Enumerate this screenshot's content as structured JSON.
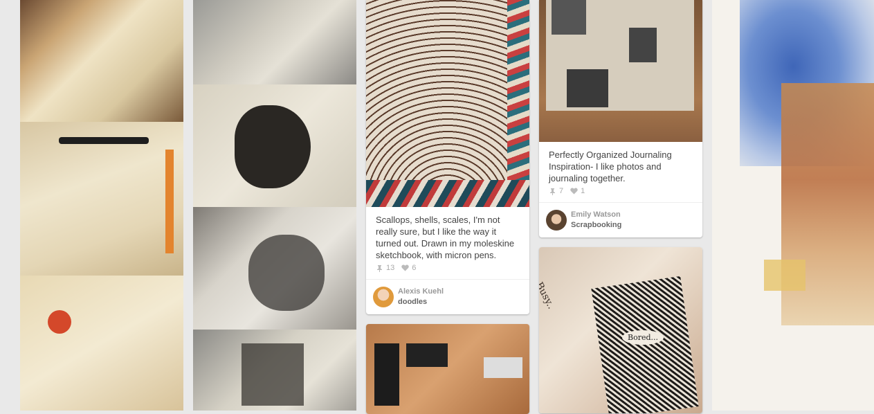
{
  "pins": [
    {
      "description": "Scallops, shells, scales, I'm not really sure, but I like the way it turned out. Drawn in my moleskine sketchbook, with micron pens.",
      "repins": "13",
      "likes": "6",
      "user": "Alexis Kuehl",
      "board": "doodles"
    },
    {
      "description": "Perfectly Organized Journaling Inspiration- I like photos and journaling together.",
      "repins": "7",
      "likes": "1",
      "user": "Emily Watson",
      "board": "Scrapbooking"
    }
  ],
  "images": {
    "busy_text": "Busy..",
    "bored_text": "Bored..."
  },
  "icons": {
    "repin": "pushpin-icon",
    "like": "heart-icon"
  },
  "colors": {
    "background": "#e9e9e9",
    "card": "#ffffff",
    "text": "#444444"
  }
}
